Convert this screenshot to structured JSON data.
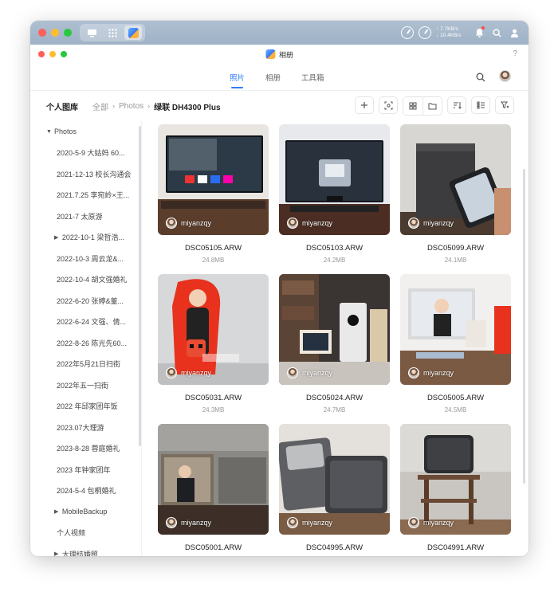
{
  "system": {
    "net_up": "↑ 7.7KB/s",
    "net_down": "↓ 10.4KB/s",
    "cpu_label": "CPU",
    "ram_label": "RAM"
  },
  "app": {
    "title": "相册",
    "help": "?"
  },
  "tabs": [
    {
      "label": "照片",
      "active": true
    },
    {
      "label": "相册",
      "active": false
    },
    {
      "label": "工具箱",
      "active": false
    }
  ],
  "library": {
    "title": "个人图库",
    "breadcrumb": [
      "全部",
      "Photos",
      "绿联 DH4300 Plus"
    ]
  },
  "sidebar": {
    "root": "Photos",
    "items": [
      {
        "label": "2020-5-9 大姑妈 60...",
        "expandable": false
      },
      {
        "label": "2021-12-13 校长沟通会",
        "expandable": false
      },
      {
        "label": "2021.7.25 李宛岭×王...",
        "expandable": false
      },
      {
        "label": "2021-7 太原游",
        "expandable": false
      },
      {
        "label": "2022-10-1 梁哲浩...",
        "expandable": true
      },
      {
        "label": "2022-10-3 周云龙&...",
        "expandable": false
      },
      {
        "label": "2022-10-4 胡文强婚礼",
        "expandable": false
      },
      {
        "label": "2022-6-20 张婷&董...",
        "expandable": false
      },
      {
        "label": "2022-6-24 文强、倩...",
        "expandable": false
      },
      {
        "label": "2022-8-26 陈光先60...",
        "expandable": false
      },
      {
        "label": "2022年5月21日扫街",
        "expandable": false
      },
      {
        "label": "2022年五一扫街",
        "expandable": false
      },
      {
        "label": "2022 年邱家团年饭",
        "expandable": false
      },
      {
        "label": "2023.07大理游",
        "expandable": false
      },
      {
        "label": "2023-8-28 蓉庭婚礼",
        "expandable": false
      },
      {
        "label": "2023 年钟家团年",
        "expandable": false
      },
      {
        "label": "2024-5-4 包桐婚礼",
        "expandable": false
      }
    ],
    "after": [
      {
        "label": "MobileBackup",
        "expandable": true,
        "indent": 1
      },
      {
        "label": "个人视频",
        "expandable": false,
        "indent": 0
      },
      {
        "label": "大理结婚照",
        "expandable": true,
        "indent": 1
      }
    ]
  },
  "photos": [
    {
      "name": "DSC05105.ARW",
      "size": "24.8MB",
      "watermark": "miyanzqy"
    },
    {
      "name": "DSC05103.ARW",
      "size": "24.2MB",
      "watermark": "miyanzqy"
    },
    {
      "name": "DSC05099.ARW",
      "size": "24.1MB",
      "watermark": "miyanzqy"
    },
    {
      "name": "DSC05031.ARW",
      "size": "24.3MB",
      "watermark": "miyanzqy"
    },
    {
      "name": "DSC05024.ARW",
      "size": "24.7MB",
      "watermark": "miyanzqy"
    },
    {
      "name": "DSC05005.ARW",
      "size": "24.5MB",
      "watermark": "miyanzqy"
    },
    {
      "name": "DSC05001.ARW",
      "size": "",
      "watermark": "miyanzqy"
    },
    {
      "name": "DSC04995.ARW",
      "size": "",
      "watermark": "miyanzqy"
    },
    {
      "name": "DSC04991.ARW",
      "size": "",
      "watermark": "miyanzqy"
    }
  ],
  "colors": {
    "accent": "#2f7cf6",
    "topbar": "#a5b7ca"
  }
}
